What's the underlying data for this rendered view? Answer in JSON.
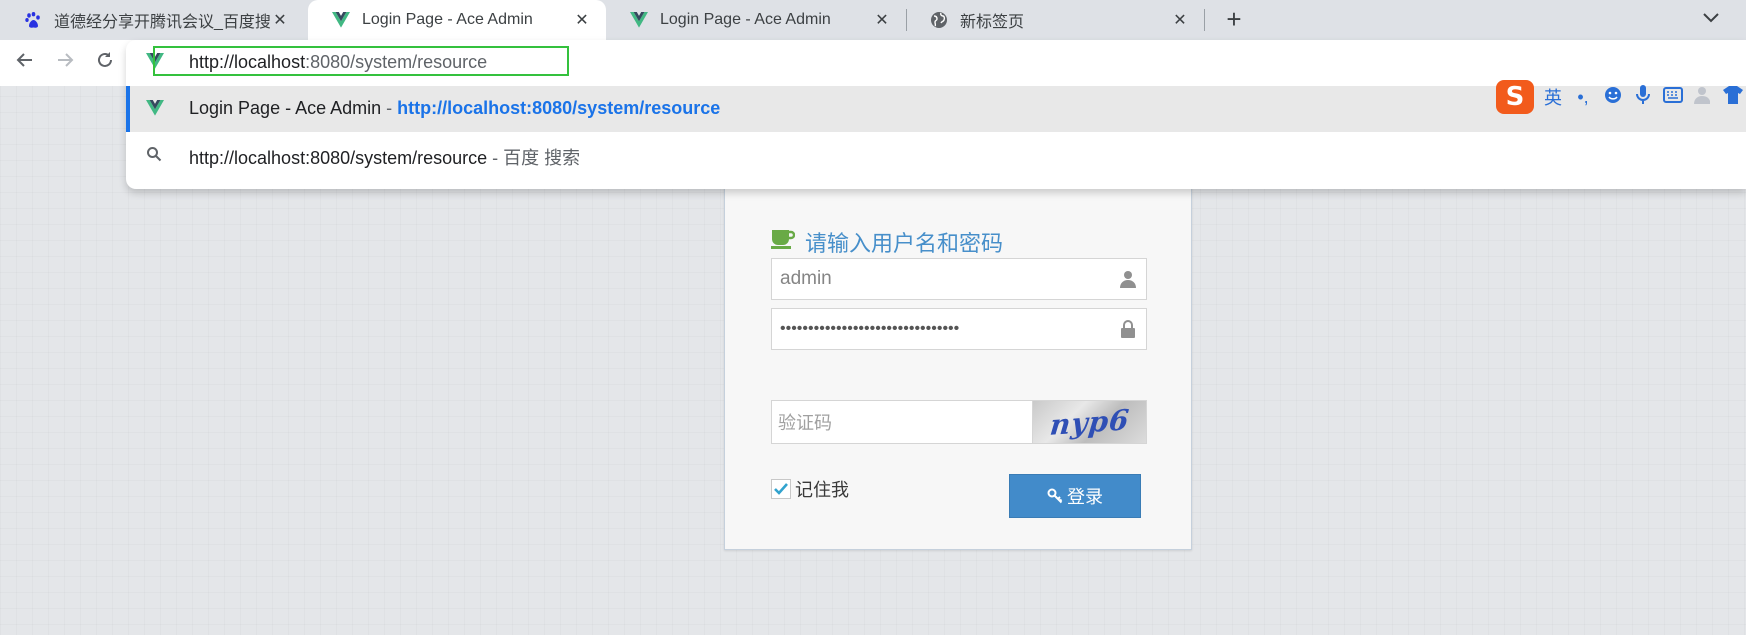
{
  "tabs": [
    {
      "title": "道德经分享开腾讯会议_百度搜索",
      "icon": "baidu-paw-icon",
      "active": false
    },
    {
      "title": "Login Page - Ace Admin",
      "icon": "vue-logo-icon",
      "active": true
    },
    {
      "title": "Login Page - Ace Admin",
      "icon": "vue-logo-icon",
      "active": false
    },
    {
      "title": "新标签页",
      "icon": "globe-icon",
      "active": false
    }
  ],
  "toolbar": {
    "back": "←",
    "forward": "→",
    "reload": "⟳",
    "new_tab": "+",
    "tab_search": "⌄"
  },
  "omnibox": {
    "url_host": "http://localhost",
    "url_rest": ":8080/system/resource",
    "suggestions": [
      {
        "title": "Login Page - Ace Admin",
        "separator": " - ",
        "url": "http://localhost:8080/system/resource"
      },
      {
        "query": "http://localhost:8080/system/resource",
        "separator": " - ",
        "engine": "百度 搜索"
      }
    ]
  },
  "ime": {
    "logo": "S",
    "lang": "英",
    "punct": "•,"
  },
  "login": {
    "header": "请输入用户名和密码",
    "username": "admin",
    "password_mask": "••••••••••••••••••••••••••••••••",
    "captcha_placeholder": "验证码",
    "captcha_code": "nyp6",
    "remember_label": "记住我",
    "remember_checked": true,
    "submit_label": "登录"
  },
  "colors": {
    "accent": "#428bca",
    "header_text": "#478fca",
    "focus_ring": "#34c13d",
    "link": "#1a73e8",
    "vue_green": "#41b883",
    "vue_dark": "#35495e"
  }
}
